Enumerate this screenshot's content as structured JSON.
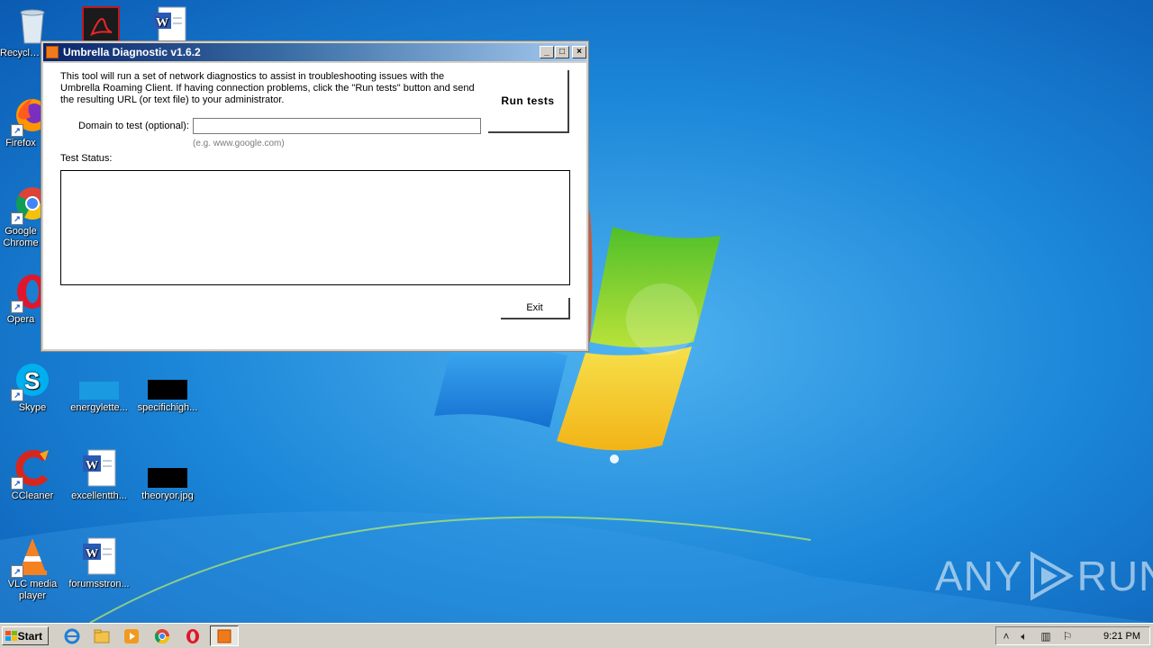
{
  "window": {
    "title": "Umbrella Diagnostic v1.6.2",
    "minimize_glyph": "_",
    "maximize_glyph": "□",
    "close_glyph": "×",
    "description": "This tool will run a set of network diagnostics to assist in troubleshooting issues with the Umbrella Roaming Client.  If having connection problems, click the \"Run tests\" button and send the resulting URL (or text file) to your administrator.",
    "run_button": "Run tests",
    "domain_label": "Domain to test (optional):",
    "domain_value": "",
    "domain_hint": "(e.g. www.google.com)",
    "status_label": "Test Status:",
    "status_text": "",
    "exit_button": "Exit"
  },
  "desktop_icons": [
    {
      "label": "Recycle Bin",
      "icon": "recycle-bin-icon"
    },
    {
      "label": "",
      "icon": "acrobat-icon"
    },
    {
      "label": "",
      "icon": "word-doc-icon"
    },
    {
      "label": "Firefox",
      "icon": "firefox-icon"
    },
    {
      "label": "Google Chrome",
      "icon": "chrome-icon"
    },
    {
      "label": "Opera",
      "icon": "opera-icon"
    },
    {
      "label": "Skype",
      "icon": "skype-icon"
    },
    {
      "label": "energylette...",
      "icon": "file-icon"
    },
    {
      "label": "specifichigh...",
      "icon": "image-file-icon"
    },
    {
      "label": "CCleaner",
      "icon": "ccleaner-icon"
    },
    {
      "label": "excellentth...",
      "icon": "word-doc-icon"
    },
    {
      "label": "theoryor.jpg",
      "icon": "image-file-icon"
    },
    {
      "label": "VLC media player",
      "icon": "vlc-icon"
    },
    {
      "label": "forumsstron...",
      "icon": "word-doc-icon"
    }
  ],
  "watermark": {
    "left": "ANY",
    "right": "RUN"
  },
  "taskbar": {
    "start_label": "Start",
    "clock": "9:21 PM",
    "tray_expand": "˄"
  },
  "colors": {
    "accent_title": "#0a246a",
    "desktop_blue": "#1a7fd1"
  }
}
